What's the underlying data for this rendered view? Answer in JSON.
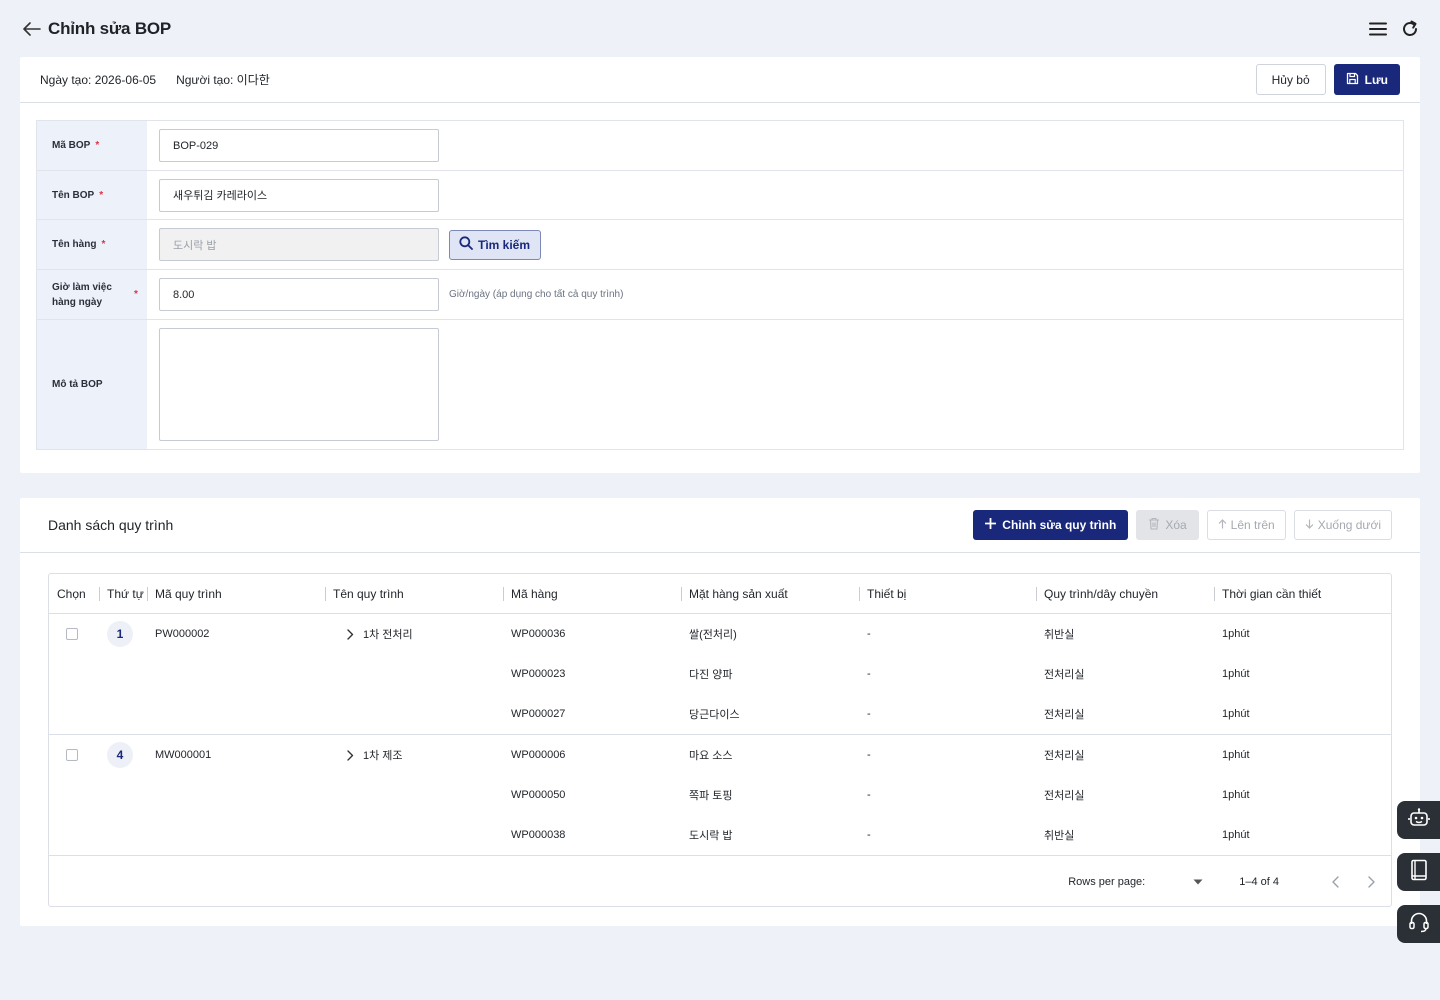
{
  "header": {
    "title": "Chỉnh sửa BOP",
    "back_icon": "arrow-left-icon",
    "menu_icon": "hamburger-icon",
    "refresh_icon": "refresh-icon"
  },
  "meta": {
    "created_date": "Ngày tạo: 2026-06-05",
    "creator": "Người tạo: 이다한",
    "cancel_label": "Hủy bỏ",
    "save_label": "Lưu"
  },
  "form": {
    "code_label": "Mã BOP",
    "code_value": "BOP-029",
    "name_label": "Tên BOP",
    "name_value": "새우튀김 카레라이스",
    "item_label": "Tên hàng",
    "item_value": "도시락 밥",
    "search_label": "Tìm kiếm",
    "hours_label": "Giờ làm việc hàng ngày",
    "hours_value": "8.00",
    "hours_hint": "Giờ/ngày (áp dụng cho tất cả quy trình)",
    "desc_label": "Mô tả BOP",
    "required_mark": "*"
  },
  "process_list": {
    "title": "Danh sách quy trình",
    "edit_label": "Chỉnh sửa quy trình",
    "delete_label": "Xóa",
    "up_label": "Lên trên",
    "down_label": "Xuống dưới",
    "columns": [
      "Chọn",
      "Thứ tự",
      "Mã quy trình",
      "Tên quy trình",
      "Mã hàng",
      "Mặt hàng sản xuất",
      "Thiết bị",
      "Quy trình/dây chuyền",
      "Thời gian cần thiết"
    ],
    "groups": [
      {
        "order": "1",
        "code": "PW000002",
        "name": "1차 전처리",
        "items": [
          {
            "item_code": "WP000036",
            "product": "쌀(전처리)",
            "equipment": "-",
            "line": "취반실",
            "time": "1phút"
          },
          {
            "item_code": "WP000023",
            "product": "다진 양파",
            "equipment": "-",
            "line": "전처리실",
            "time": "1phút"
          },
          {
            "item_code": "WP000027",
            "product": "당근다이스",
            "equipment": "-",
            "line": "전처리실",
            "time": "1phút"
          }
        ]
      },
      {
        "order": "4",
        "code": "MW000001",
        "name": "1차 제조",
        "items": [
          {
            "item_code": "WP000006",
            "product": "마요 소스",
            "equipment": "-",
            "line": "전처리실",
            "time": "1phút"
          },
          {
            "item_code": "WP000050",
            "product": "쪽파 토핑",
            "equipment": "-",
            "line": "전처리실",
            "time": "1phút"
          },
          {
            "item_code": "WP000038",
            "product": "도시락 밥",
            "equipment": "-",
            "line": "취반실",
            "time": "1phút"
          }
        ]
      }
    ],
    "rows_per_page_label": "Rows per page:",
    "page_info": "1–4 of 4"
  },
  "floating": {
    "bot_icon": "robot-icon",
    "book_icon": "book-icon",
    "support_icon": "headset-icon"
  },
  "colors": {
    "primary": "#19287a",
    "required": "#d9364b",
    "label_bg": "#edf1fa"
  }
}
